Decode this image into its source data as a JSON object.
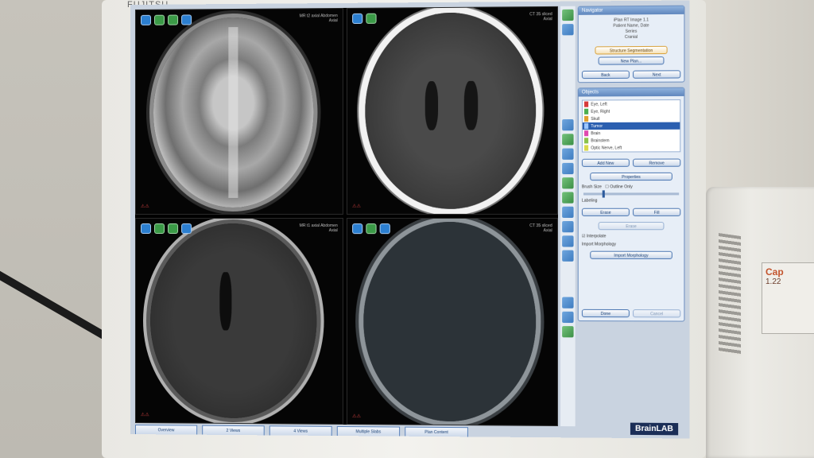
{
  "monitor": {
    "brand": "FUJITSU"
  },
  "viewports": [
    {
      "name": "top-left-mri-t2",
      "info_line1": "MR t2 axial Abdomen",
      "info_line2": "Axial"
    },
    {
      "name": "top-right-ct",
      "info_line1": "CT 35 sliced",
      "info_line2": "Axial"
    },
    {
      "name": "bottom-left-mri-t1",
      "info_line1": "MR t1 axial Abdomen",
      "info_line2": "Axial"
    },
    {
      "name": "bottom-right-ct",
      "info_line1": "CT 35 sliced",
      "info_line2": "Axial"
    }
  ],
  "panel": {
    "navigator_title": "Navigator",
    "navigator_text": [
      "iPlan RT Image 1.1",
      "Patient Name, Date",
      "Series",
      "Cranial"
    ],
    "structure_seg_btn": "Structure Segmentation",
    "new_plan_btn": "New Plan...",
    "back_btn": "Back",
    "next_btn": "Next",
    "objects_title": "Objects",
    "objects": [
      {
        "label": "Eye, Left",
        "color": "#d63b3b"
      },
      {
        "label": "Eye, Right",
        "color": "#4caf50"
      },
      {
        "label": "Skull",
        "color": "#e0a030"
      },
      {
        "label": "Tumor",
        "color": "#2a5db0",
        "selected": true
      },
      {
        "label": "Brain",
        "color": "#e04ab0"
      },
      {
        "label": "Brainstem",
        "color": "#8bc34a"
      },
      {
        "label": "Optic Nerve, Left",
        "color": "#d9d94a"
      }
    ],
    "add_btn": "Add New",
    "remove_btn": "Remove",
    "properties_btn": "Properties",
    "brush_size_label": "Brush Size",
    "outline_label": "Outline Only",
    "labeling_label": "Labeling",
    "erase_btn": "Erase",
    "erase2_btn": "Erase",
    "fill_btn": "Fill",
    "interpolate_label": "Interpolate",
    "import_label": "Import Morphology",
    "import_btn": "Import Morphology",
    "done_btn": "Done",
    "cancel_btn": "Cancel",
    "logo": "BrainLAB"
  },
  "tabs": [
    "Overview",
    "2 Views",
    "4 Views",
    "Multiple Slabs",
    "Plan Content"
  ],
  "device": {
    "brand": "Cap",
    "label_text": "1.22"
  }
}
